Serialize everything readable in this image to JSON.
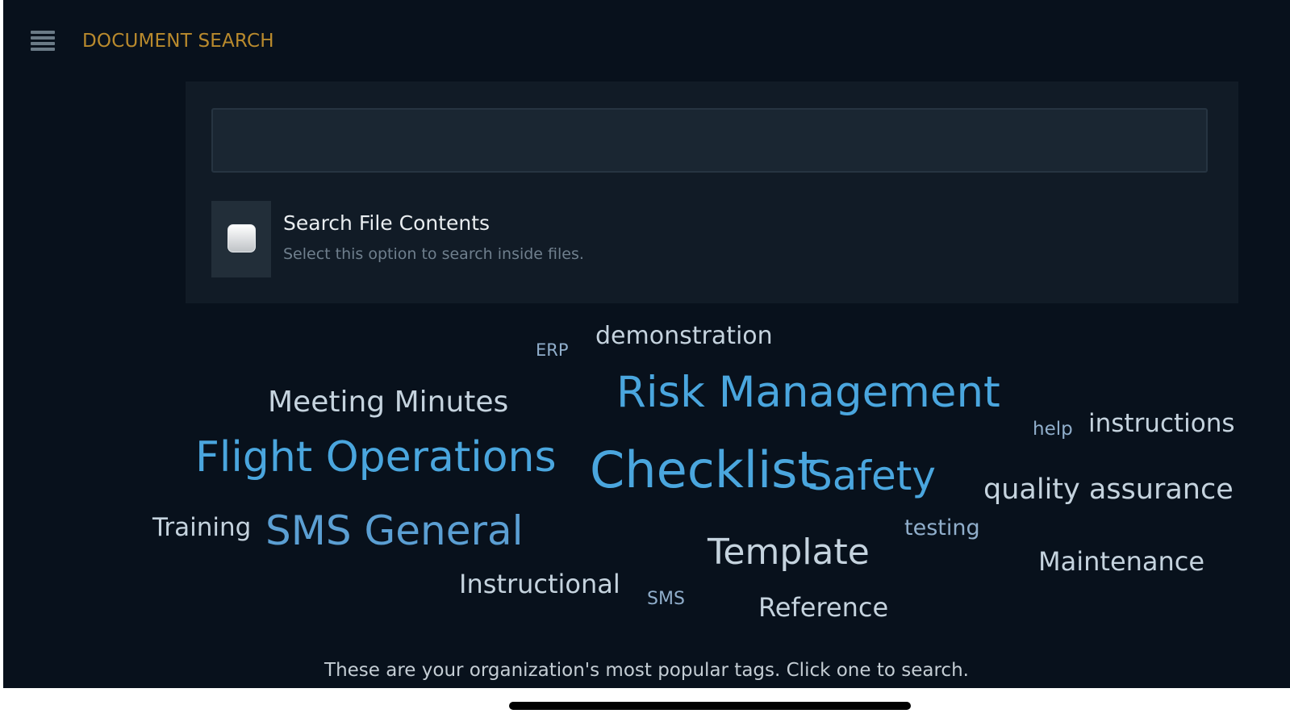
{
  "header": {
    "menu_icon": "hamburger-menu-icon",
    "title": "DOCUMENT SEARCH"
  },
  "search": {
    "value": "",
    "placeholder": ""
  },
  "file_contents_option": {
    "checked": false,
    "title": "Search File Contents",
    "description": "Select this option to search inside files."
  },
  "tags": [
    "ERP",
    "demonstration",
    "Meeting Minutes",
    "Risk Management",
    "help",
    "instructions",
    "Flight Operations",
    "Checklist",
    "Safety",
    "quality assurance",
    "Training",
    "SMS General",
    "testing",
    "Template",
    "Maintenance",
    "Instructional",
    "SMS",
    "Reference"
  ],
  "footer_note": "These are your organization's most popular tags. Click one to search.",
  "colors": {
    "background": "#08111c",
    "panel": "#111b26",
    "accent_title": "#b98a2d",
    "tag_primary": "#4aa6de",
    "tag_secondary": "#c5d3de"
  }
}
